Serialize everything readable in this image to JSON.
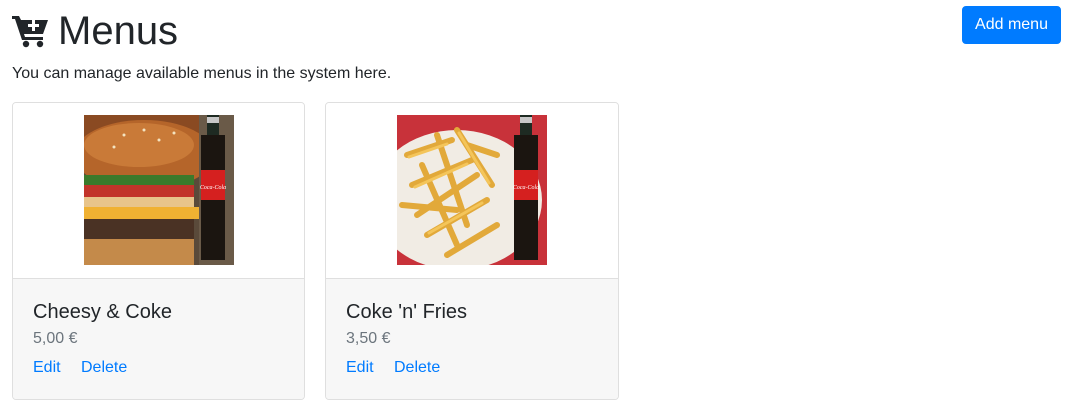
{
  "header": {
    "icon": "cart-plus-icon",
    "title": "Menus",
    "add_button_label": "Add menu"
  },
  "subtitle": "You can manage available menus in the system here.",
  "colors": {
    "primary": "#007bff",
    "muted": "#6c757d",
    "card_body_bg": "#f7f7f7"
  },
  "menus": [
    {
      "name": "Cheesy & Coke",
      "price": "5,00 €",
      "image": "burger-and-coke-photo",
      "edit_label": "Edit",
      "delete_label": "Delete"
    },
    {
      "name": "Coke 'n' Fries",
      "price": "3,50 €",
      "image": "fries-and-coke-photo",
      "edit_label": "Edit",
      "delete_label": "Delete"
    }
  ]
}
